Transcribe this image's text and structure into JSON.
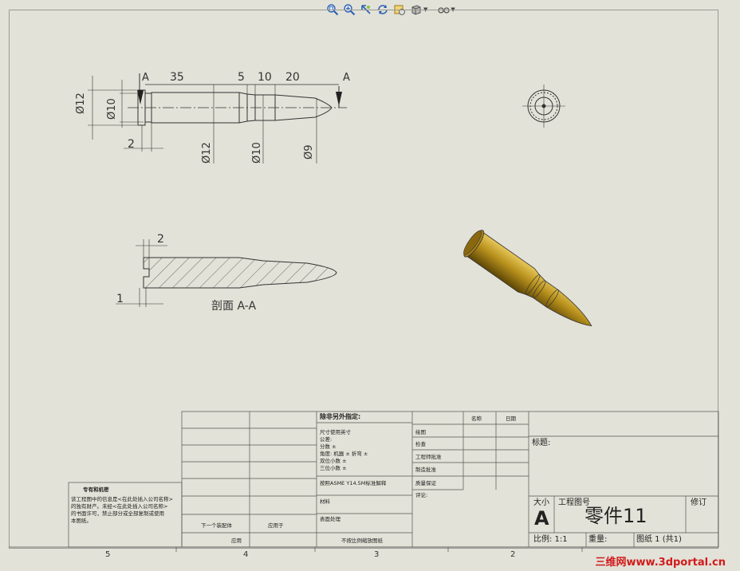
{
  "toolbar": {
    "icons": [
      "zoom-to-fit-icon",
      "zoom-area-icon",
      "previous-view-icon",
      "rebuild-icon",
      "view-settings-icon",
      "display-style-icon",
      "hide-show-icon"
    ]
  },
  "views": {
    "top_dims": {
      "d35": "35",
      "d5": "5",
      "d10": "10",
      "d20": "20",
      "d2": "2",
      "section_left": "A",
      "section_right": "A"
    },
    "diameters": {
      "d12_left": "Ø12",
      "d10_left": "Ø10",
      "d12_bottom": "Ø12",
      "d10_bottom": "Ø10",
      "d9_bottom": "Ø9"
    },
    "section": {
      "dim_2": "2",
      "dim_1": "1",
      "label": "剖面 A-A"
    }
  },
  "title_block": {
    "unless_noted": "除非另外指定:",
    "dims_in": "尺寸使用英寸",
    "tolerance": "公差:",
    "fraction": "分数 ±",
    "angle": "角度: 机器 ±    折弯 ±",
    "two_places": "双位小数  ±",
    "three_places": "三位小数  ±",
    "interpret": "按照ASME Y14.5M标准解释",
    "material": "材料",
    "finish": "表面处理",
    "next_assy": "下一个装配体",
    "used_on": "应用于",
    "application": "应用",
    "do_not_scale": "不按比例缩放图纸",
    "col_name": "名称",
    "col_date": "日期",
    "drawn": "绘图",
    "checked": "检查",
    "eng_appr": "工程师批准",
    "mfg_appr": "制造批准",
    "qa": "质量保证",
    "comments": "评论:",
    "title_label": "标题:",
    "size_label": "大小",
    "size_value": "A",
    "dwg_no_label": "工程图号",
    "dwg_no_value": "零件11",
    "rev_label": "修订",
    "scale": "比例: 1:1",
    "weight": "重量:",
    "sheet": "图纸 1 (共1)",
    "proprietary_title": "专有和机密",
    "proprietary_l1": "该工程图中的信息是<在此处插入公司名称>",
    "proprietary_l2": "的独有财产。未经<在此处插入公司名称>",
    "proprietary_l3": "的书面许可，禁止部分或全部复制或使用",
    "proprietary_l4": "本图纸。"
  },
  "zones": [
    "5",
    "4",
    "3",
    "2"
  ],
  "watermark": {
    "part1": "三维网",
    "part2": "www.3dportal.cn"
  },
  "colors": {
    "paper": "#e2e2d8",
    "line": "#333333",
    "bullet_body": "#b8911c",
    "watermark_red": "#d21a1a"
  }
}
